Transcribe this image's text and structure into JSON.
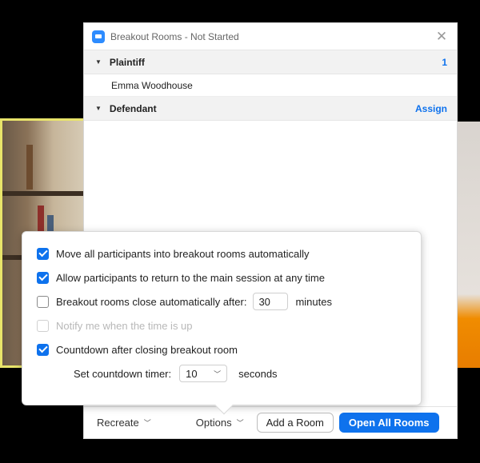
{
  "window": {
    "title": "Breakout Rooms - Not Started",
    "close_glyph": "✕"
  },
  "rooms": [
    {
      "name": "Plaintiff",
      "right_text": "1",
      "participants": [
        "Emma Woodhouse"
      ]
    },
    {
      "name": "Defendant",
      "right_text": "Assign",
      "participants": []
    }
  ],
  "options": {
    "move_auto": {
      "label": "Move all participants into breakout rooms automatically",
      "checked": true
    },
    "allow_return": {
      "label": "Allow participants to return to the main session at any time",
      "checked": true
    },
    "auto_close": {
      "label": "Breakout rooms close automatically after:",
      "checked": false,
      "value": "30",
      "unit": "minutes"
    },
    "notify": {
      "label": "Notify me when the time is up",
      "checked": false,
      "disabled": true
    },
    "countdown": {
      "label": "Countdown after closing breakout room",
      "checked": true
    },
    "countdown_timer": {
      "label": "Set countdown timer:",
      "value": "10",
      "unit": "seconds"
    }
  },
  "footer": {
    "recreate_label": "Recreate",
    "options_label": "Options",
    "add_room_label": "Add a Room",
    "open_all_label": "Open All Rooms"
  },
  "colors": {
    "accent": "#0e72ed",
    "left_tile_border": "#e8e46a"
  },
  "icons": {
    "app": "zoom-camera-icon",
    "caret": "caret-down-icon",
    "chevron": "chevron-down-icon",
    "check": "checkmark-icon"
  }
}
